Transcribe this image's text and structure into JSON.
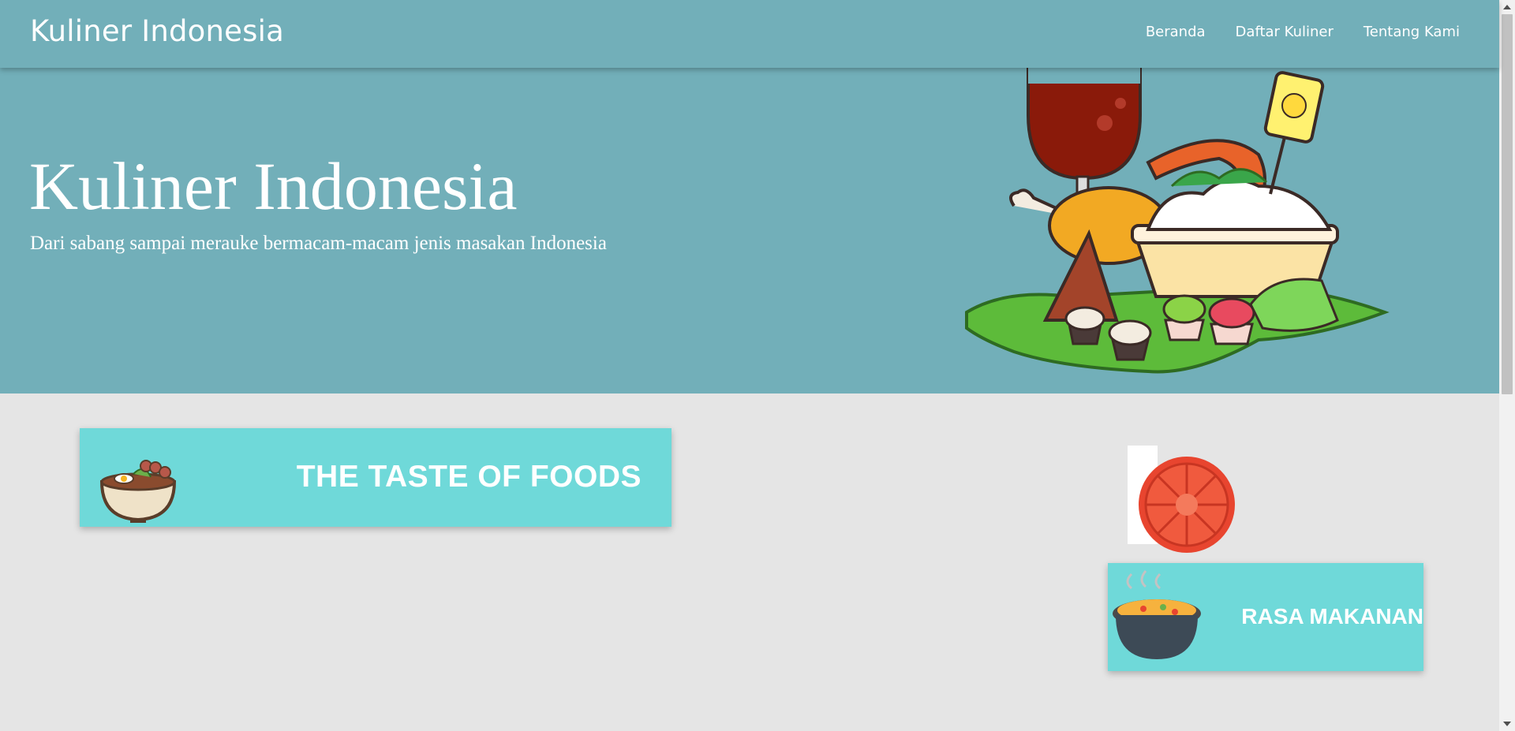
{
  "navbar": {
    "brand": "Kuliner Indonesia",
    "links": [
      "Beranda",
      "Daftar Kuliner",
      "Tentang Kami"
    ]
  },
  "hero": {
    "title": "Kuliner Indonesia",
    "subtitle": "Dari sabang sampai merauke bermacam-macam jenis masakan Indonesia"
  },
  "cards": [
    {
      "label": "THE TASTE OF FOODS",
      "icon": "noodle-bowl-icon"
    },
    {
      "label": "RASA MAKANAN",
      "icon": "soup-pot-icon"
    }
  ],
  "colors": {
    "header": "#72afb9",
    "background": "#e5e5e5",
    "card": "#6fd9d9"
  }
}
